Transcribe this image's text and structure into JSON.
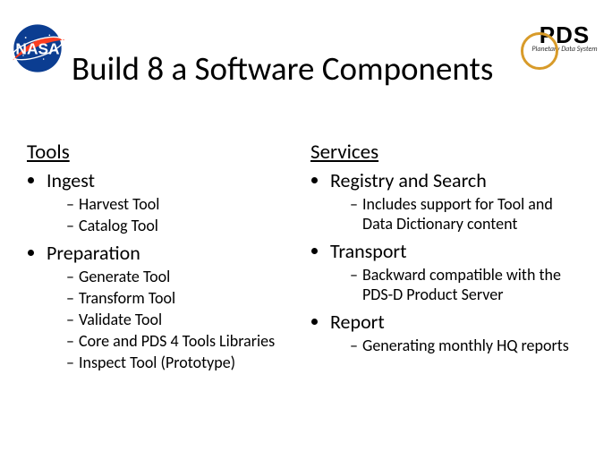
{
  "title": "Build 8 a Software Components",
  "logos": {
    "nasa_alt": "NASA",
    "pds_text": "PDS",
    "pds_sub": "Planetary Data System"
  },
  "left": {
    "heading": "Tools",
    "items": [
      {
        "label": "Ingest",
        "sub": [
          "Harvest Tool",
          "Catalog Tool"
        ]
      },
      {
        "label": "Preparation",
        "sub": [
          "Generate Tool",
          "Transform Tool",
          "Validate Tool",
          "Core and PDS 4 Tools Libraries",
          "Inspect Tool (Prototype)"
        ]
      }
    ]
  },
  "right": {
    "heading": "Services",
    "items": [
      {
        "label": "Registry and Search",
        "sub": [
          "Includes support for Tool and Data Dictionary content"
        ]
      },
      {
        "label": "Transport",
        "sub": [
          "Backward compatible with the PDS-D Product Server"
        ]
      },
      {
        "label": "Report",
        "sub": [
          "Generating monthly HQ reports"
        ]
      }
    ]
  }
}
